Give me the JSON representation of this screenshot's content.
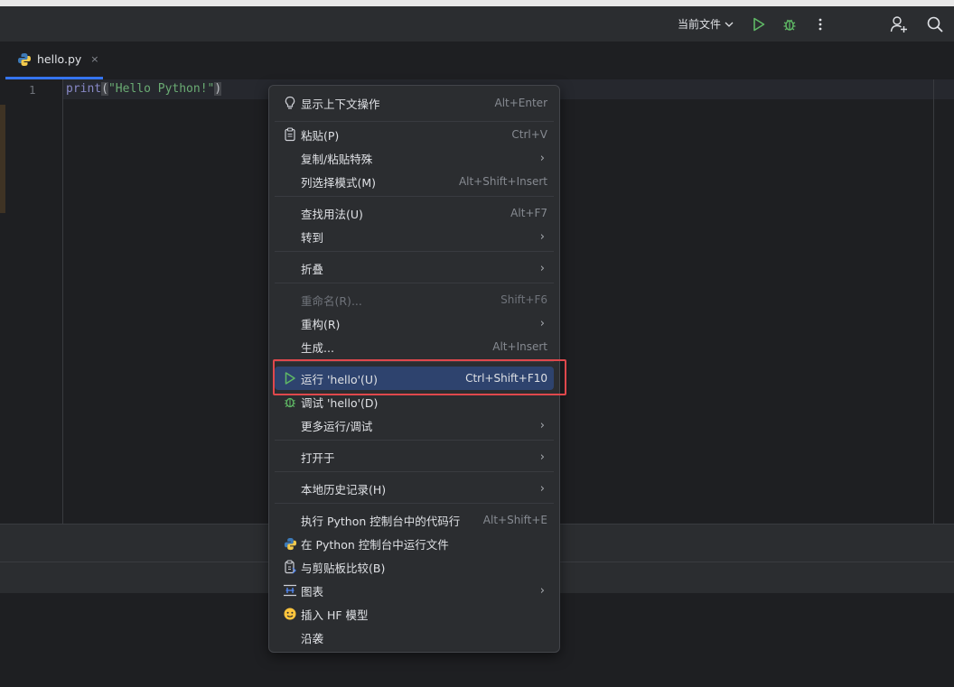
{
  "toolbar": {
    "run_config_label": "当前文件",
    "icons": [
      "run-icon",
      "debug-icon",
      "more-vert-icon",
      "add-user-icon",
      "search-icon"
    ]
  },
  "tab": {
    "label": "hello.py",
    "close": "×"
  },
  "editor": {
    "line_number": "1",
    "code": {
      "fn": "print",
      "open": "(",
      "str": "\"Hello Python!\"",
      "close": ")"
    }
  },
  "context_menu": {
    "items": [
      {
        "label": "显示上下文操作",
        "shortcut": "Alt+Enter",
        "icon": "bulb-icon"
      },
      {
        "label": "粘贴(P)",
        "shortcut": "Ctrl+V",
        "icon": "clipboard-icon"
      },
      {
        "label": "复制/粘贴特殊",
        "shortcut": ""
      },
      {
        "label": "列选择模式(M)",
        "shortcut": "Alt+Shift+Insert"
      },
      {
        "label": "查找用法(U)",
        "shortcut": "Alt+F7"
      },
      {
        "label": "转到",
        "shortcut": ""
      },
      {
        "label": "折叠",
        "shortcut": ""
      },
      {
        "label": "重命名(R)...",
        "shortcut": "Shift+F6",
        "disabled": true
      },
      {
        "label": "重构(R)",
        "shortcut": ""
      },
      {
        "label": "生成...",
        "shortcut": "Alt+Insert"
      },
      {
        "label": "运行 'hello'(U)",
        "shortcut": "Ctrl+Shift+F10",
        "icon": "run-icon",
        "selected": true
      },
      {
        "label": "调试 'hello'(D)",
        "shortcut": "",
        "icon": "debug-icon"
      },
      {
        "label": "更多运行/调试",
        "shortcut": ""
      },
      {
        "label": "打开于",
        "shortcut": ""
      },
      {
        "label": "本地历史记录(H)",
        "shortcut": ""
      },
      {
        "label": "执行 Python 控制台中的代码行",
        "shortcut": "Alt+Shift+E"
      },
      {
        "label": "在 Python 控制台中运行文件",
        "shortcut": "",
        "icon": "python-icon"
      },
      {
        "label": "与剪贴板比较(B)",
        "shortcut": "",
        "icon": "compare-clipboard-icon"
      },
      {
        "label": "图表",
        "shortcut": "",
        "icon": "diagram-icon"
      },
      {
        "label": "插入 HF 模型",
        "shortcut": "",
        "icon": "hugging-face-icon"
      },
      {
        "label": "沿袭",
        "shortcut": ""
      }
    ],
    "submenu_arrow": "›"
  },
  "colors": {
    "accent": "#3574f0",
    "highlight_border": "#e0484c",
    "run_green": "#5fb865",
    "selected_bg": "#2e436e"
  }
}
